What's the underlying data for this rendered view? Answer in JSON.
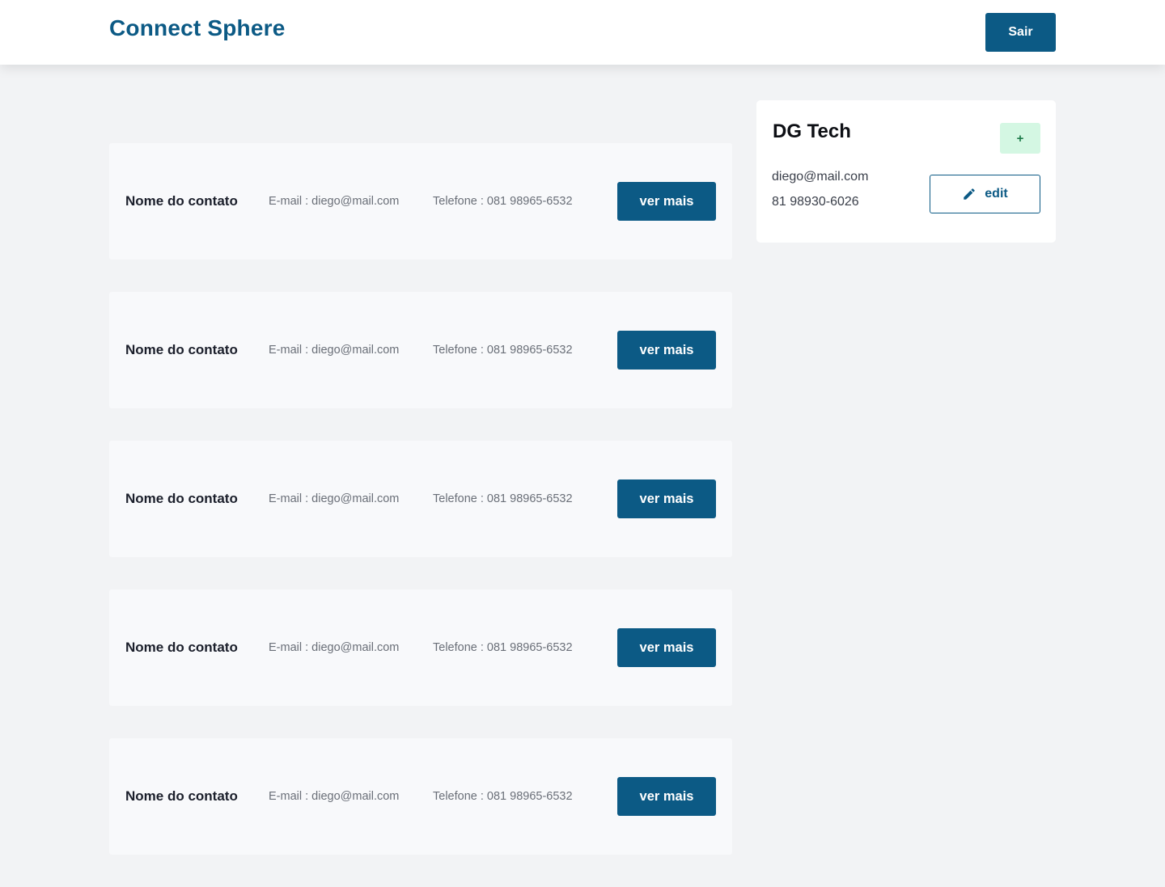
{
  "header": {
    "logo": "Connect Sphere",
    "logout_label": "Sair"
  },
  "contacts": [
    {
      "name": "Nome do contato",
      "email": "E-mail : diego@mail.com",
      "phone": "Telefone : 081 98965-6532",
      "action_label": "ver mais"
    },
    {
      "name": "Nome do contato",
      "email": "E-mail : diego@mail.com",
      "phone": "Telefone : 081 98965-6532",
      "action_label": "ver mais"
    },
    {
      "name": "Nome do contato",
      "email": "E-mail : diego@mail.com",
      "phone": "Telefone : 081 98965-6532",
      "action_label": "ver mais"
    },
    {
      "name": "Nome do contato",
      "email": "E-mail : diego@mail.com",
      "phone": "Telefone : 081 98965-6532",
      "action_label": "ver mais"
    },
    {
      "name": "Nome do contato",
      "email": "E-mail : diego@mail.com",
      "phone": "Telefone : 081 98965-6532",
      "action_label": "ver mais"
    }
  ],
  "company": {
    "name": "DG Tech",
    "add_label": "+",
    "email": "diego@mail.com",
    "phone": "81 98930-6026",
    "edit_label": "edit",
    "edit_icon": "pencil-icon"
  },
  "colors": {
    "primary": "#0c5a85",
    "background": "#f2f3f5",
    "card": "#f8f9fb",
    "add_button_bg": "#d4f7e3"
  }
}
